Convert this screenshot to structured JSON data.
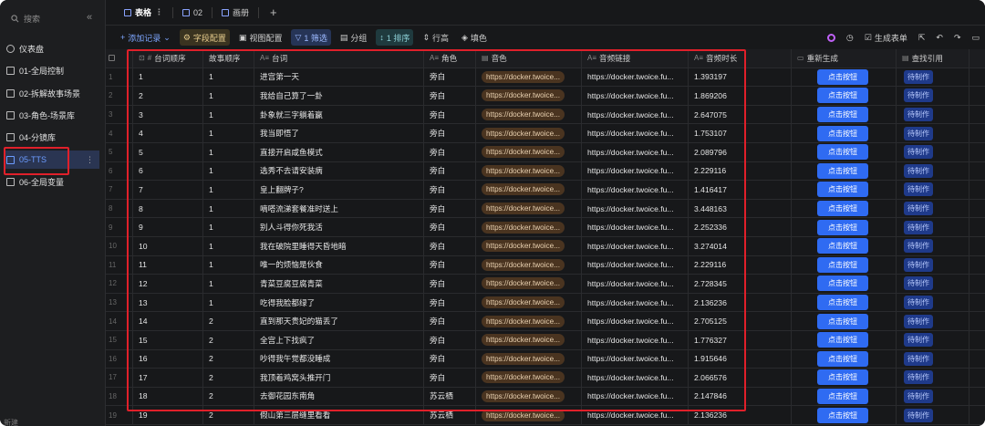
{
  "sidebar": {
    "search_placeholder": "搜索",
    "collapse_icon": "double-chevron-left-icon",
    "items": [
      {
        "label": "仪表盘",
        "icon": "dashboard-icon",
        "active": false
      },
      {
        "label": "01-全局控制",
        "icon": "table-icon",
        "active": false
      },
      {
        "label": "02-拆解故事场景",
        "icon": "table-icon",
        "active": false
      },
      {
        "label": "03-角色-场景库",
        "icon": "table-icon",
        "active": false
      },
      {
        "label": "04-分镜库",
        "icon": "table-icon",
        "active": false
      },
      {
        "label": "05-TTS",
        "icon": "table-icon",
        "active": true
      },
      {
        "label": "06-全局变量",
        "icon": "table-icon",
        "active": false
      }
    ],
    "footer": "新建"
  },
  "tabs": [
    {
      "label": "表格",
      "active": true
    },
    {
      "label": "02",
      "active": false
    },
    {
      "label": "画册",
      "active": false
    }
  ],
  "toolbar": {
    "add_record": "添加记录",
    "field_config": "字段配置",
    "view_config": "视图配置",
    "filter": "1 筛选",
    "group": "分组",
    "sort": "1 排序",
    "row_height": "行高",
    "fill_color": "填色",
    "generate_form": "生成表单"
  },
  "columns": [
    "台词顺序",
    "故事顺序",
    "台词",
    "角色",
    "音色",
    "音频链接",
    "音频时长",
    "重新生成",
    "查找引用"
  ],
  "button_label": "点击按钮",
  "tag_label": "待制作",
  "rows": [
    {
      "n": "1",
      "line_order": "1",
      "story_order": "1",
      "line": "进宫第一天",
      "role": "旁白",
      "voice": "https://docker.twoice...",
      "link": "https://docker.twoice.fu...",
      "duration": "1.393197"
    },
    {
      "n": "2",
      "line_order": "2",
      "story_order": "1",
      "line": "我给自己算了一卦",
      "role": "旁白",
      "voice": "https://docker.twoice...",
      "link": "https://docker.twoice.fu...",
      "duration": "1.869206"
    },
    {
      "n": "3",
      "line_order": "3",
      "story_order": "1",
      "line": "卦象就三字躺着赢",
      "role": "旁白",
      "voice": "https://docker.twoice...",
      "link": "https://docker.twoice.fu...",
      "duration": "2.647075"
    },
    {
      "n": "4",
      "line_order": "4",
      "story_order": "1",
      "line": "我当即悟了",
      "role": "旁白",
      "voice": "https://docker.twoice...",
      "link": "https://docker.twoice.fu...",
      "duration": "1.753107"
    },
    {
      "n": "5",
      "line_order": "5",
      "story_order": "1",
      "line": "直接开启咸鱼模式",
      "role": "旁白",
      "voice": "https://docker.twoice...",
      "link": "https://docker.twoice.fu...",
      "duration": "2.089796"
    },
    {
      "n": "6",
      "line_order": "6",
      "story_order": "1",
      "line": "选秀不去请安装病",
      "role": "旁白",
      "voice": "https://docker.twoice...",
      "link": "https://docker.twoice.fu...",
      "duration": "2.229116"
    },
    {
      "n": "7",
      "line_order": "7",
      "story_order": "1",
      "line": "皇上翻牌子?",
      "role": "旁白",
      "voice": "https://docker.twoice...",
      "link": "https://docker.twoice.fu...",
      "duration": "1.416417"
    },
    {
      "n": "8",
      "line_order": "8",
      "story_order": "1",
      "line": "嘀嗒流涕套餐准时送上",
      "role": "旁白",
      "voice": "https://docker.twoice...",
      "link": "https://docker.twoice.fu...",
      "duration": "3.448163"
    },
    {
      "n": "9",
      "line_order": "9",
      "story_order": "1",
      "line": "别人斗得你死我活",
      "role": "旁白",
      "voice": "https://docker.twoice...",
      "link": "https://docker.twoice.fu...",
      "duration": "2.252336"
    },
    {
      "n": "10",
      "line_order": "10",
      "story_order": "1",
      "line": "我在破院里睡得天昏地暗",
      "role": "旁白",
      "voice": "https://docker.twoice...",
      "link": "https://docker.twoice.fu...",
      "duration": "3.274014"
    },
    {
      "n": "11",
      "line_order": "11",
      "story_order": "1",
      "line": "唯一的烦恼是伙食",
      "role": "旁白",
      "voice": "https://docker.twoice...",
      "link": "https://docker.twoice.fu...",
      "duration": "2.229116"
    },
    {
      "n": "12",
      "line_order": "12",
      "story_order": "1",
      "line": "青菜豆腐豆腐青菜",
      "role": "旁白",
      "voice": "https://docker.twoice...",
      "link": "https://docker.twoice.fu...",
      "duration": "2.728345"
    },
    {
      "n": "13",
      "line_order": "13",
      "story_order": "1",
      "line": "吃得我脸都绿了",
      "role": "旁白",
      "voice": "https://docker.twoice...",
      "link": "https://docker.twoice.fu...",
      "duration": "2.136236"
    },
    {
      "n": "14",
      "line_order": "14",
      "story_order": "2",
      "line": "直到那天贵妃的猫丢了",
      "role": "旁白",
      "voice": "https://docker.twoice...",
      "link": "https://docker.twoice.fu...",
      "duration": "2.705125"
    },
    {
      "n": "15",
      "line_order": "15",
      "story_order": "2",
      "line": "全宫上下找疯了",
      "role": "旁白",
      "voice": "https://docker.twoice...",
      "link": "https://docker.twoice.fu...",
      "duration": "1.776327"
    },
    {
      "n": "16",
      "line_order": "16",
      "story_order": "2",
      "line": "吵得我午觉都没睡成",
      "role": "旁白",
      "voice": "https://docker.twoice...",
      "link": "https://docker.twoice.fu...",
      "duration": "1.915646"
    },
    {
      "n": "17",
      "line_order": "17",
      "story_order": "2",
      "line": "我顶着鸡窝头推开门",
      "role": "旁白",
      "voice": "https://docker.twoice...",
      "link": "https://docker.twoice.fu...",
      "duration": "2.066576"
    },
    {
      "n": "18",
      "line_order": "18",
      "story_order": "2",
      "line": "去御花园东南角",
      "role": "苏云栖",
      "voice": "https://docker.twoice...",
      "link": "https://docker.twoice.fu...",
      "duration": "2.147846"
    },
    {
      "n": "19",
      "line_order": "19",
      "story_order": "2",
      "line": "假山第三层缝里看看",
      "role": "苏云栖",
      "voice": "https://docker.twoice...",
      "link": "https://docker.twoice.fu...",
      "duration": "2.136236"
    }
  ],
  "colors": {
    "accent": "#2f6bf2",
    "highlight_box": "#e0202a",
    "voice_pill": "#4a3420"
  }
}
